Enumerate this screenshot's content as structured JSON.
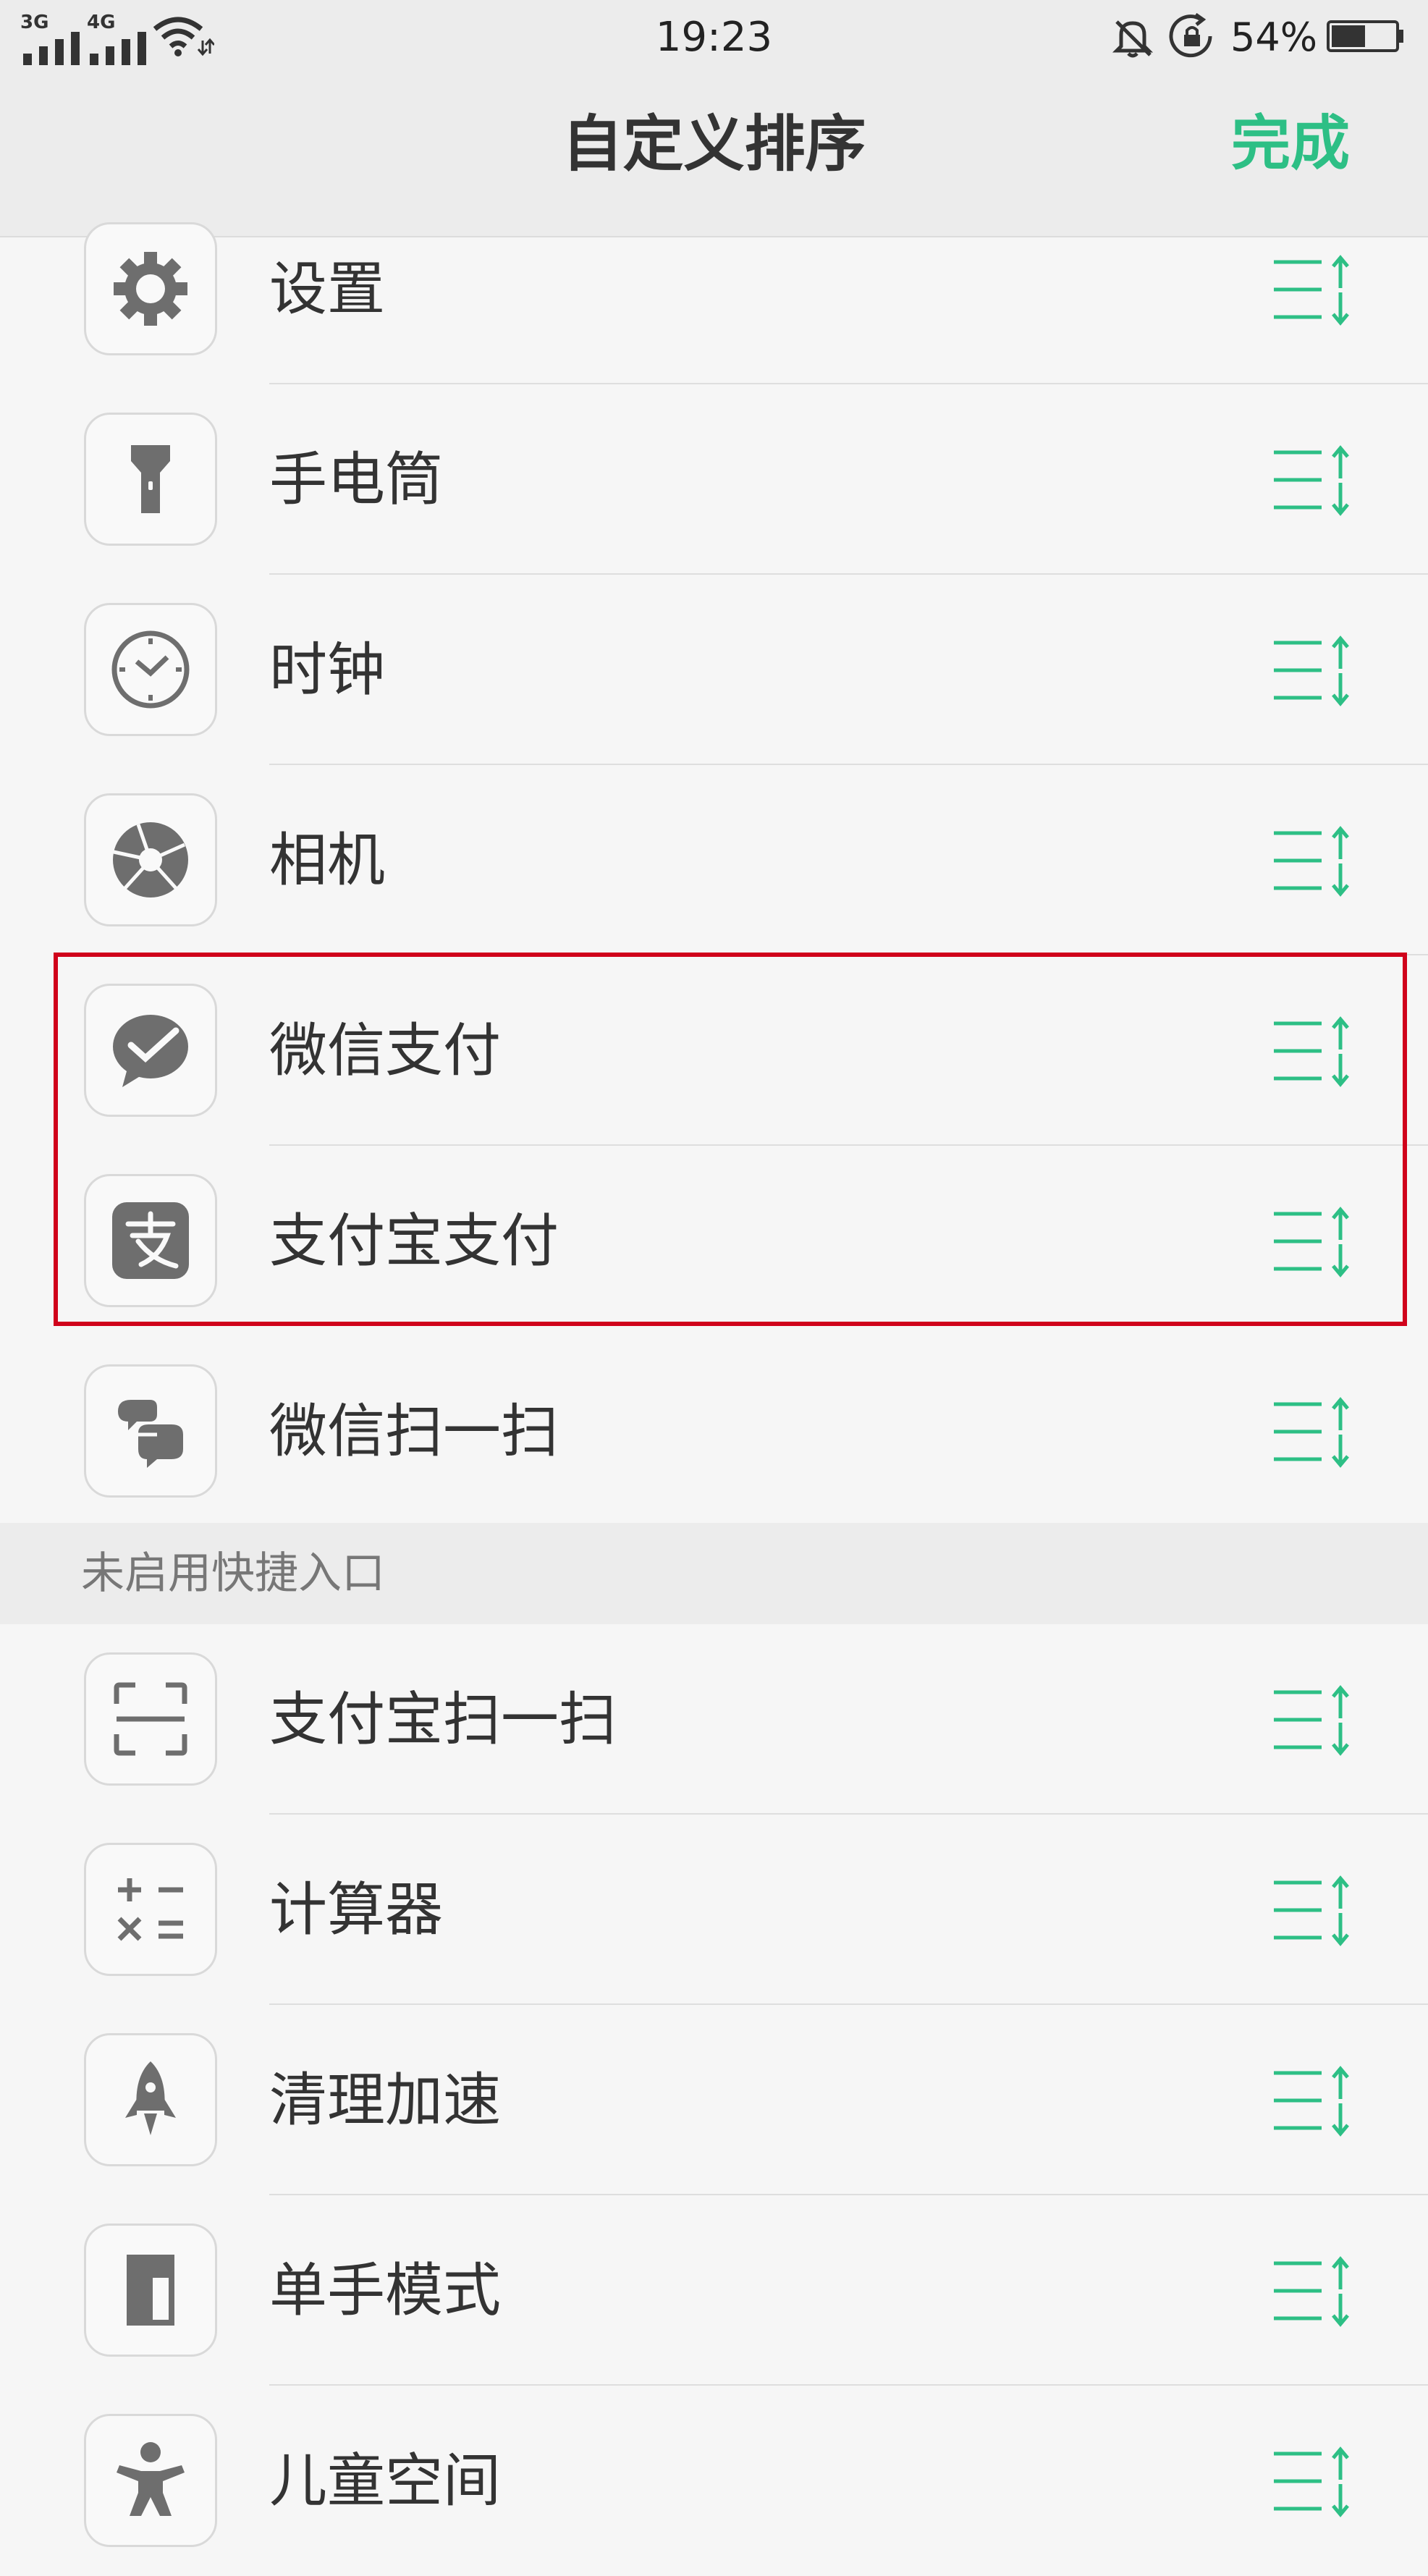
{
  "status_bar": {
    "network_1": "3G",
    "network_2": "4G",
    "time": "19:23",
    "battery_percent": "54%",
    "battery_level": 0.54,
    "icons": [
      "signal-icon",
      "wifi-icon",
      "mute-bell-icon",
      "rotation-lock-icon",
      "battery-icon"
    ]
  },
  "header": {
    "title": "自定义排序",
    "done_label": "完成"
  },
  "enabled_items": [
    {
      "label": "设置",
      "icon": "gear-icon"
    },
    {
      "label": "手电筒",
      "icon": "flashlight-icon"
    },
    {
      "label": "时钟",
      "icon": "clock-icon"
    },
    {
      "label": "相机",
      "icon": "camera-aperture-icon"
    },
    {
      "label": "微信支付",
      "icon": "wechat-pay-icon"
    },
    {
      "label": "支付宝支付",
      "icon": "alipay-icon"
    },
    {
      "label": "微信扫一扫",
      "icon": "wechat-scan-icon"
    }
  ],
  "disabled_section": {
    "title": "未启用快捷入口",
    "items": [
      {
        "label": "支付宝扫一扫",
        "icon": "scan-frame-icon"
      },
      {
        "label": "计算器",
        "icon": "calculator-icon"
      },
      {
        "label": "清理加速",
        "icon": "rocket-icon"
      },
      {
        "label": "单手模式",
        "icon": "one-hand-mode-icon"
      },
      {
        "label": "儿童空间",
        "icon": "child-space-icon"
      }
    ]
  },
  "colors": {
    "accent": "#2dbf85",
    "highlight": "#d0021b",
    "icon_gray": "#6e6e6e"
  }
}
